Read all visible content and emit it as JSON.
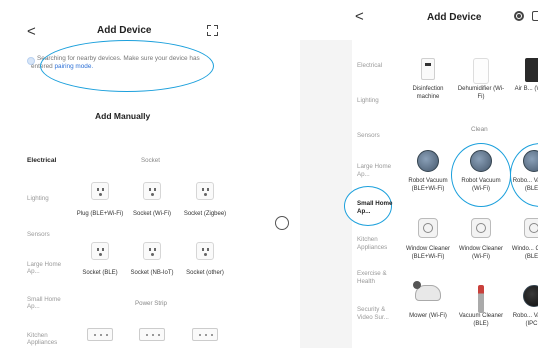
{
  "left": {
    "back_glyph": "<",
    "title": "Add Device",
    "scan_icon": "scan-icon",
    "search": {
      "text": "Searching for nearby devices. Make sure your device has entered",
      "link": "pairing mode."
    },
    "manual_title": "Add Manually",
    "categories": [
      "Electrical",
      "Lighting",
      "Sensors",
      "Large Home Ap...",
      "Small Home Ap...",
      "Kitchen Appliances"
    ],
    "selected_category": "Electrical",
    "groups": {
      "socket": "Socket",
      "power_strip": "Power Strip"
    },
    "sockets": [
      {
        "label": "Plug (BLE+Wi-Fi)"
      },
      {
        "label": "Socket (Wi-Fi)"
      },
      {
        "label": "Socket (Zigbee)"
      },
      {
        "label": "Socket (BLE)"
      },
      {
        "label": "Socket (NB-IoT)"
      },
      {
        "label": "Socket (other)"
      }
    ]
  },
  "right": {
    "back_glyph": "<",
    "title": "Add Device",
    "settings_icon": "settings-icon",
    "categories": [
      "Electrical",
      "Lighting",
      "Sensors",
      "Large Home Ap...",
      "Small Home Ap...",
      "Kitchen Appliances",
      "Exercise & Health",
      "Security & Video Sur..."
    ],
    "selected_category": "Small Home Ap...",
    "clean_label": "Clean",
    "devices": [
      {
        "label": "Disinfection machine",
        "icon": "disinfection-icon"
      },
      {
        "label": "Dehumidifier (Wi-Fi)",
        "icon": "dehumidifier-icon"
      },
      {
        "label": "Air B... (Wi-F...",
        "icon": "air-box-icon"
      },
      {
        "label": "Robot Vacuum (BLE+Wi-Fi)",
        "icon": "robot-vacuum-icon"
      },
      {
        "label": "Robot Vacuum (Wi-Fi)",
        "icon": "robot-vacuum-icon"
      },
      {
        "label": "Robo... Vacuu... (BLE...",
        "icon": "robot-vacuum-icon"
      },
      {
        "label": "Window Cleaner (BLE+Wi-Fi)",
        "icon": "window-cleaner-icon"
      },
      {
        "label": "Window Cleaner (Wi-Fi)",
        "icon": "window-cleaner-icon"
      },
      {
        "label": "Windo... Clean... (BLE...",
        "icon": "window-cleaner-icon"
      },
      {
        "label": "Mower (Wi-Fi)",
        "icon": "mower-icon"
      },
      {
        "label": "Vacuum Cleaner (BLE)",
        "icon": "stick-vacuum-icon"
      },
      {
        "label": "Robo... Vacuu... (IPC...",
        "icon": "robot-vacuum-icon"
      }
    ]
  },
  "colors": {
    "accent": "#1ca0dc",
    "link": "#2b6fd6"
  }
}
